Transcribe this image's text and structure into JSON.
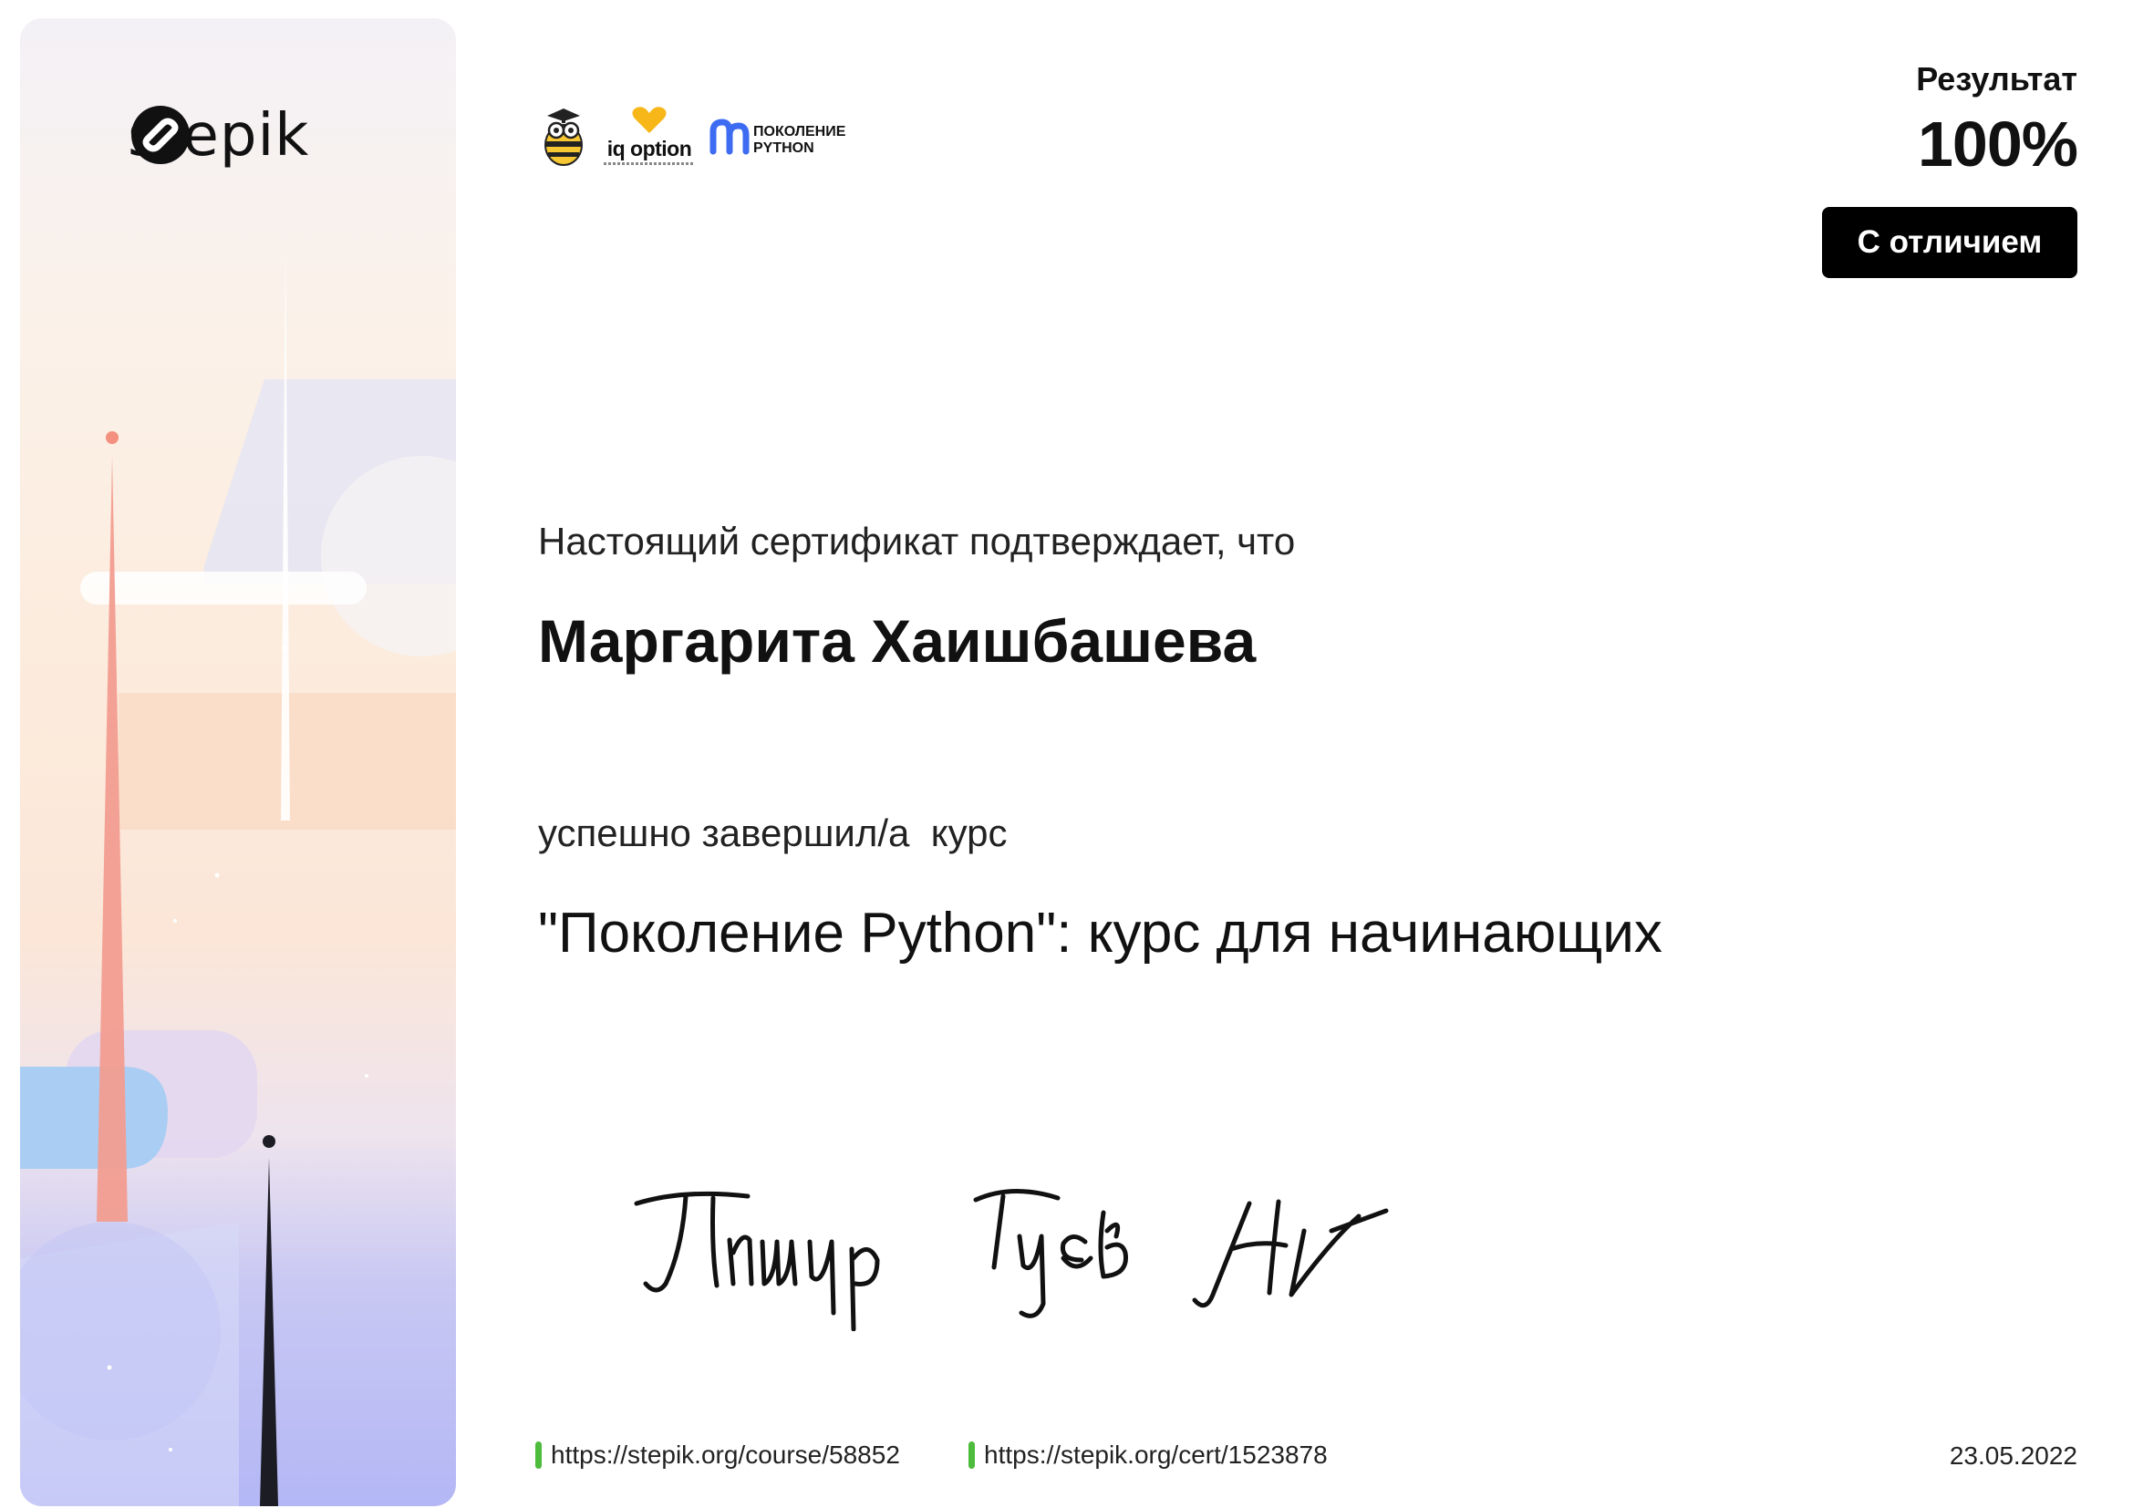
{
  "branding": {
    "logo_text": "stepik",
    "partners": {
      "bee": "bee-mascot-icon",
      "iq_option": "iq option",
      "pokolenie_python": "ПОКОЛЕНИЕ\nPYTHON"
    }
  },
  "result": {
    "label": "Результат",
    "value": "100%",
    "badge": "С отличием"
  },
  "certificate": {
    "intro": "Настоящий сертификат подтверждает, что",
    "recipient": "Маргарита Хаишбашева",
    "completed": "успешно завершил/а  курс",
    "course_name": "\"Поколение Python\": курс для начинающих"
  },
  "footer": {
    "course_link": "https://stepik.org/course/58852",
    "cert_link": "https://stepik.org/cert/1523878",
    "date": "23.05.2022"
  },
  "colors": {
    "link_marker": "#4dbb3c",
    "badge_bg": "#000000",
    "accent_red": "#f08a82",
    "accent_blue": "#9fc4f3"
  }
}
